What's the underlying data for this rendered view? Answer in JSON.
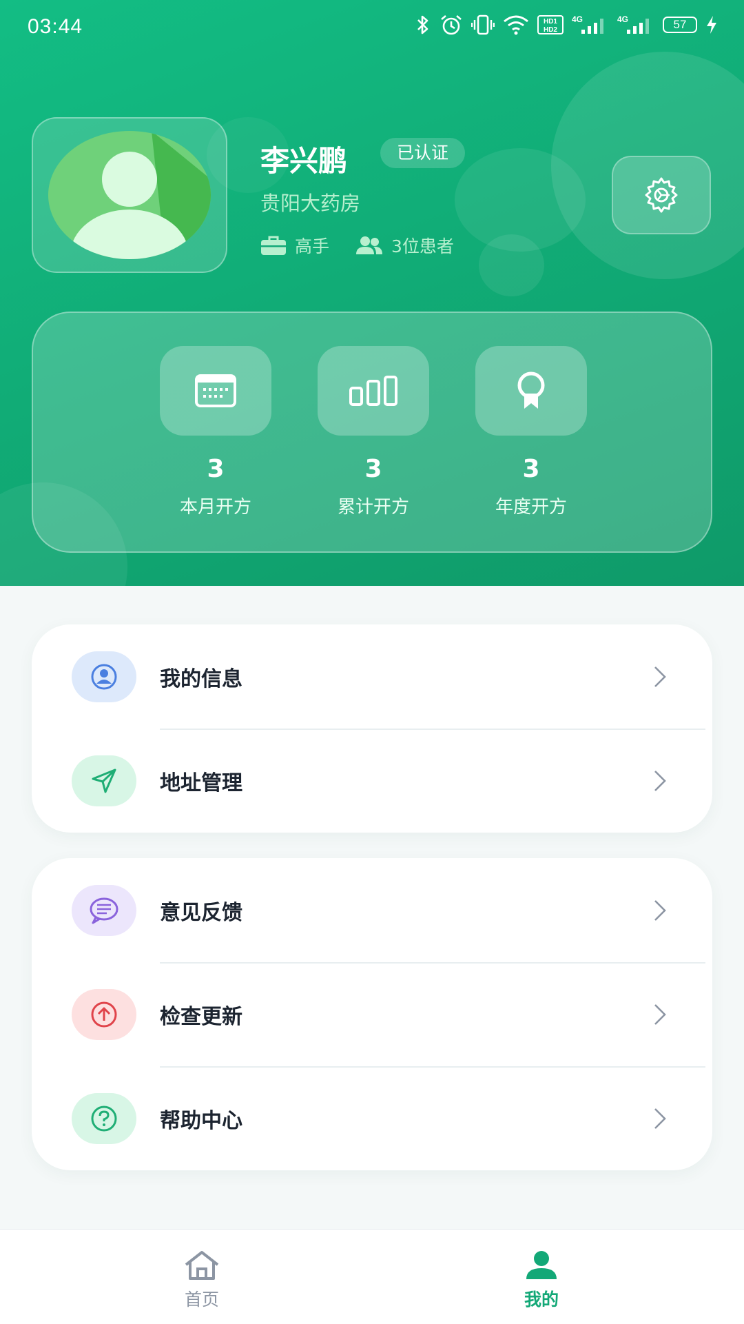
{
  "status_bar": {
    "time": "03:44",
    "battery": "57",
    "icons": [
      "bluetooth-icon",
      "alarm-icon",
      "vibrate-icon",
      "wifi-icon",
      "hd-icon",
      "signal-4g-icon",
      "signal-4g-icon",
      "battery-icon",
      "charging-icon"
    ]
  },
  "profile": {
    "name": "李兴鹏",
    "verified_label": "已认证",
    "pharmacy": "贵阳大药房",
    "level": "高手",
    "patients": "3位患者"
  },
  "stats": [
    {
      "value": "3",
      "label": "本月开方",
      "icon": "calendar-icon"
    },
    {
      "value": "3",
      "label": "累计开方",
      "icon": "bar-chart-icon"
    },
    {
      "value": "3",
      "label": "年度开方",
      "icon": "award-icon"
    }
  ],
  "menu_group_1": [
    {
      "label": "我的信息",
      "icon": "user-circle-icon",
      "icon_bg": "#dde9fb",
      "icon_color": "#4a7fe0"
    },
    {
      "label": "地址管理",
      "icon": "location-arrow-icon",
      "icon_bg": "#d8f6e6",
      "icon_color": "#1fae75"
    }
  ],
  "menu_group_2": [
    {
      "label": "意见反馈",
      "icon": "message-icon",
      "icon_bg": "#ece6fc",
      "icon_color": "#8a63dc"
    },
    {
      "label": "检查更新",
      "icon": "upload-circle-icon",
      "icon_bg": "#fde0e0",
      "icon_color": "#e0434a"
    },
    {
      "label": "帮助中心",
      "icon": "help-circle-icon",
      "icon_bg": "#d8f6e6",
      "icon_color": "#1fae75"
    }
  ],
  "bottom_nav": [
    {
      "label": "首页",
      "icon": "home-icon",
      "active": false
    },
    {
      "label": "我的",
      "icon": "person-icon",
      "active": true
    }
  ],
  "colors": {
    "brand_green": "#13bd84",
    "active_tab": "#13a877",
    "inactive_tab": "#8c95a3"
  }
}
